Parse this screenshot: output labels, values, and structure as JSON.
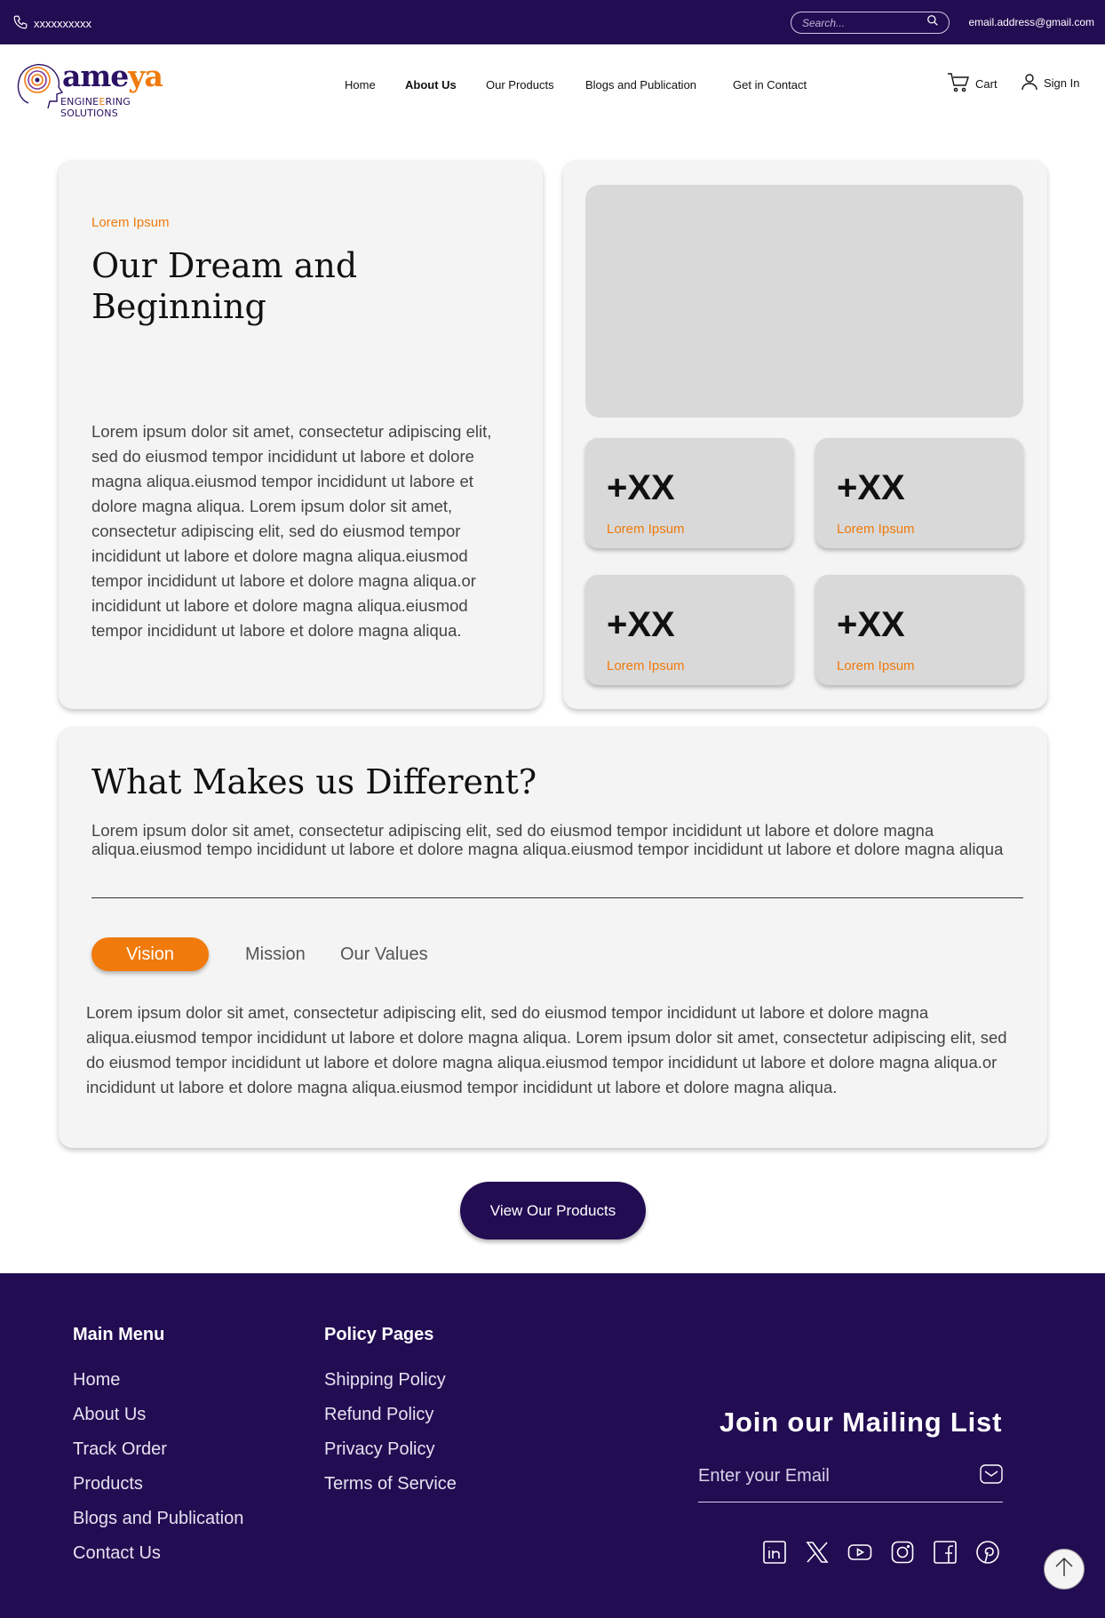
{
  "topbar": {
    "phone": "xxxxxxxxxx",
    "search_placeholder": "Search...",
    "email": "email.address@gmail.com"
  },
  "header": {
    "logo_word_main": "ame",
    "logo_word_accent": "ya",
    "logo_sub_1": "ENGINE",
    "logo_sub_accent": "E",
    "logo_sub_2": "RING SOLUTIONS",
    "nav": [
      "Home",
      "About Us",
      "Our Products",
      "Blogs and Publication",
      "Get in Contact"
    ],
    "active_nav": "About Us",
    "cart_label": "Cart",
    "signin_label": "Sign In"
  },
  "dream": {
    "kicker": "Lorem Ipsum",
    "title_line1": "Our Dream and",
    "title_line2": "Beginning",
    "body": "Lorem ipsum dolor sit amet, consectetur adipiscing elit, sed do eiusmod tempor incididunt ut labore et dolore magna aliqua.eiusmod tempor incididunt ut labore et dolore magna aliqua. Lorem ipsum dolor sit amet, consectetur adipiscing elit, sed do eiusmod tempor incididunt ut labore et dolore magna aliqua.eiusmod tempor incididunt ut labore et dolore magna aliqua.or incididunt ut labore et dolore magna aliqua.eiusmod tempor incididunt ut labore et dolore magna aliqua."
  },
  "stats": [
    {
      "value": "+XX",
      "label": "Lorem Ipsum"
    },
    {
      "value": "+XX",
      "label": "Lorem Ipsum"
    },
    {
      "value": "+XX",
      "label": "Lorem Ipsum"
    },
    {
      "value": "+XX",
      "label": "Lorem Ipsum"
    }
  ],
  "different": {
    "title": "What Makes us Different?",
    "intro": "Lorem ipsum dolor sit amet, consectetur adipiscing elit, sed do eiusmod tempor incididunt ut labore et dolore magna aliqua.eiusmod tempo incididunt ut labore et dolore magna aliqua.eiusmod tempor incididunt ut labore et dolore magna aliqua",
    "tabs": [
      "Vision",
      "Mission",
      "Our Values"
    ],
    "active_tab": "Vision",
    "tab_body": "Lorem ipsum dolor sit amet, consectetur adipiscing elit, sed do eiusmod tempor incididunt ut labore et dolore magna aliqua.eiusmod tempor incididunt ut labore et dolore magna aliqua. Lorem ipsum dolor sit amet, consectetur adipiscing elit, sed do eiusmod tempor incididunt ut labore et dolore magna aliqua.eiusmod tempor incididunt ut labore et dolore magna aliqua.or incididunt ut labore et dolore magna aliqua.eiusmod tempor incididunt ut labore et dolore magna aliqua."
  },
  "cta_label": "View Our Products",
  "footer": {
    "main_menu": {
      "title": "Main Menu",
      "items": [
        "Home",
        "About Us",
        "Track Order",
        "Products",
        "Blogs and Publication",
        "Contact Us"
      ]
    },
    "policy": {
      "title": "Policy Pages",
      "items": [
        "Shipping Policy",
        "Refund Policy",
        "Privacy Policy",
        "Terms of Service"
      ]
    },
    "mailing": {
      "title": "Join our Mailing List",
      "placeholder": "Enter your Email"
    },
    "socials": [
      "linkedin-icon",
      "x-icon",
      "youtube-icon",
      "instagram-icon",
      "facebook-icon",
      "pinterest-icon"
    ]
  },
  "colors": {
    "brand_purple": "#220c52",
    "accent_orange": "#f07a0c",
    "card_bg": "#f4f4f4",
    "placeholder_gray": "#d9d9d9"
  }
}
